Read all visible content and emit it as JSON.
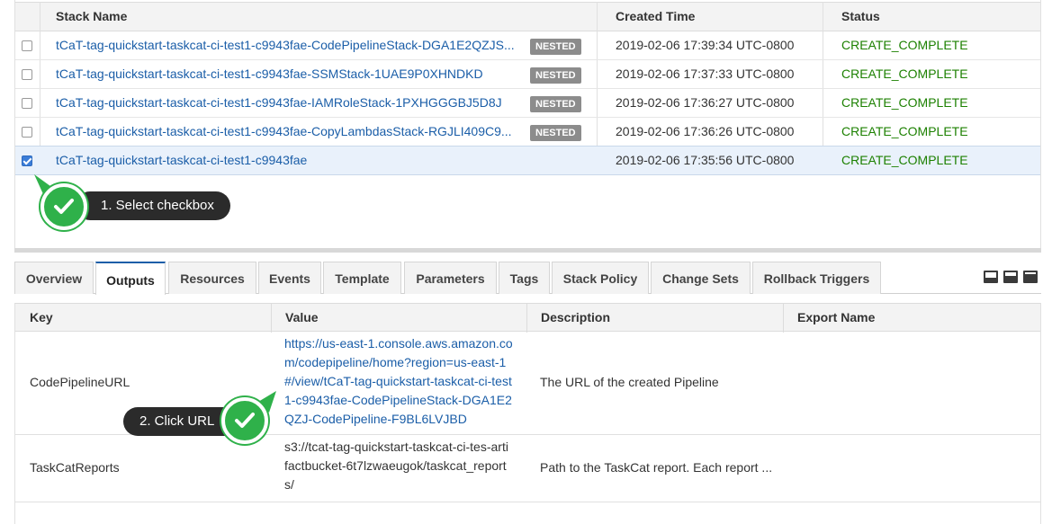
{
  "stacks_table": {
    "headers": {
      "name": "Stack Name",
      "created": "Created Time",
      "status": "Status"
    },
    "rows": [
      {
        "name": "tCaT-tag-quickstart-taskcat-ci-test1-c9943fae-CodePipelineStack-DGA1E2QZJS...",
        "badge": "NESTED",
        "created": "2019-02-06 17:39:34 UTC-0800",
        "status": "CREATE_COMPLETE",
        "checked": false
      },
      {
        "name": "tCaT-tag-quickstart-taskcat-ci-test1-c9943fae-SSMStack-1UAE9P0XHNDKD",
        "badge": "NESTED",
        "created": "2019-02-06 17:37:33 UTC-0800",
        "status": "CREATE_COMPLETE",
        "checked": false
      },
      {
        "name": "tCaT-tag-quickstart-taskcat-ci-test1-c9943fae-IAMRoleStack-1PXHGGGBJ5D8J",
        "badge": "NESTED",
        "created": "2019-02-06 17:36:27 UTC-0800",
        "status": "CREATE_COMPLETE",
        "checked": false
      },
      {
        "name": "tCaT-tag-quickstart-taskcat-ci-test1-c9943fae-CopyLambdasStack-RGJLI409C9...",
        "badge": "NESTED",
        "created": "2019-02-06 17:36:26 UTC-0800",
        "status": "CREATE_COMPLETE",
        "checked": false
      },
      {
        "name": "tCaT-tag-quickstart-taskcat-ci-test1-c9943fae",
        "badge": "",
        "created": "2019-02-06 17:35:56 UTC-0800",
        "status": "CREATE_COMPLETE",
        "checked": true
      }
    ]
  },
  "callouts": {
    "step1": "1. Select checkbox",
    "step2": "2. Click URL"
  },
  "tabs": [
    "Overview",
    "Outputs",
    "Resources",
    "Events",
    "Template",
    "Parameters",
    "Tags",
    "Stack Policy",
    "Change Sets",
    "Rollback Triggers"
  ],
  "active_tab": "Outputs",
  "outputs_table": {
    "headers": {
      "key": "Key",
      "value": "Value",
      "description": "Description",
      "export": "Export Name"
    },
    "rows": [
      {
        "key": "CodePipelineURL",
        "value_lines": [
          "https://us-east-1.console.aws.amazon.co",
          "m/codepipeline/home?region=us-east-1",
          "#/view/tCaT-tag-quickstart-taskcat-ci-test",
          "1-c9943fae-CodePipelineStack-DGA1E2",
          "QZJ-CodePipeline-F9BL6LVJBD"
        ],
        "description": "The URL of the created Pipeline",
        "export": ""
      },
      {
        "key": "TaskCatReports",
        "value_lines": [
          "s3://tcat-tag-quickstart-taskcat-ci-tes-arti",
          "factbucket-6t7lzwaeugok/taskcat_report",
          "s/"
        ],
        "description": "Path to the TaskCat report. Each report ...",
        "export": ""
      }
    ]
  },
  "colors": {
    "link": "#1b5ea8",
    "success": "#1d8102",
    "check_green": "#2fb14a",
    "badge": "#8c8c8c"
  }
}
